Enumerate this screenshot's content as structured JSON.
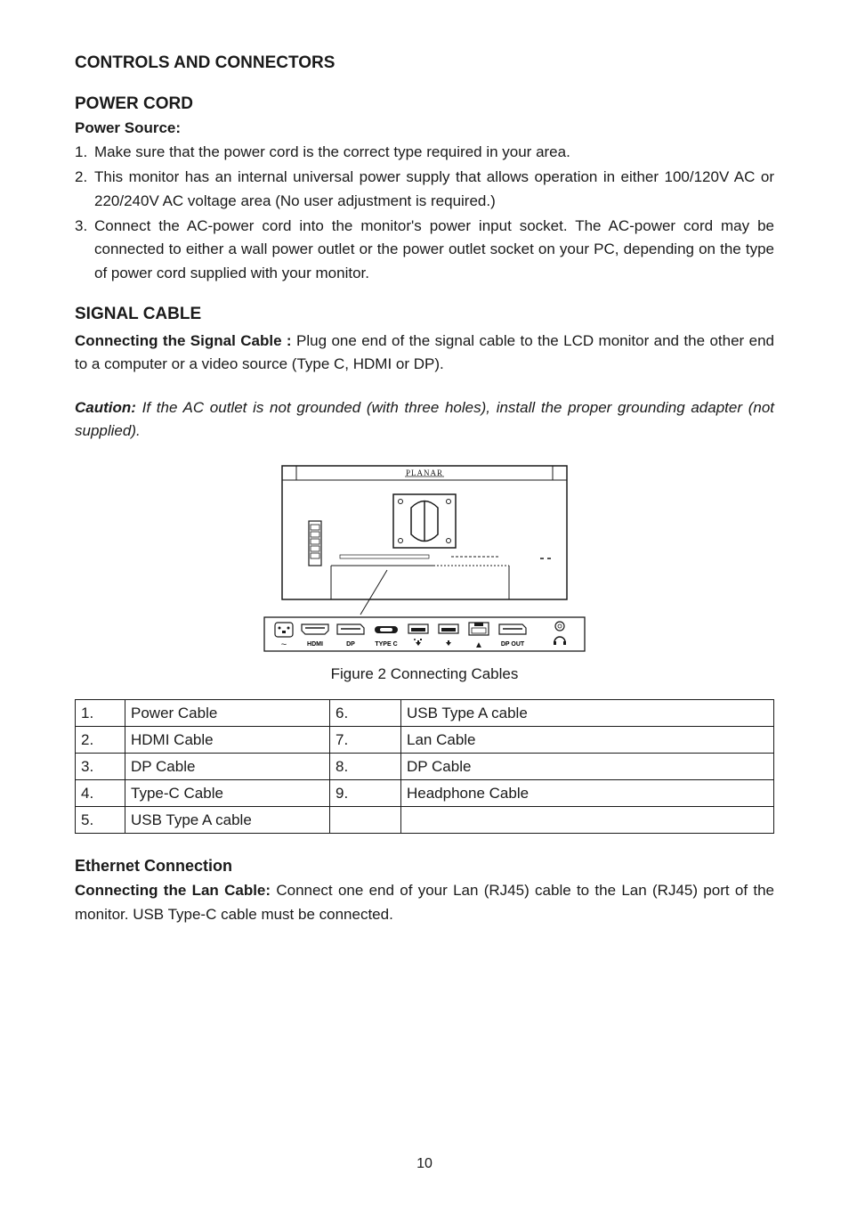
{
  "section_title": "CONTROLS AND CONNECTORS",
  "power_cord": {
    "title": "POWER CORD",
    "subtitle": "Power Source:",
    "items": [
      "Make sure that the power cord is the correct type required in your area.",
      "This monitor has an internal universal power supply that allows operation in either 100/120V AC or 220/240V AC voltage area (No user adjustment is required.)",
      "Connect the AC-power cord into the monitor's power input socket. The AC-power cord may be connected to either a wall power outlet or the power outlet socket on your PC, depending on the type of power cord supplied with your monitor."
    ]
  },
  "signal_cable": {
    "title": "SIGNAL CABLE",
    "body_bold": "Connecting the Signal Cable :",
    "body_rest": " Plug one end of the signal cable to the LCD monitor and the other end to a computer or a video source (Type C, HDMI or DP)."
  },
  "caution": {
    "label": "Caution:",
    "text": " If the AC outlet is not grounded (with three holes), install the proper grounding adapter (not supplied)."
  },
  "figure": {
    "caption": "Figure 2   Connecting Cables",
    "brand": "PLANAR",
    "ports": {
      "hdmi": "HDMI",
      "dp": "DP",
      "typec": "TYPE C",
      "dpout": "DP OUT"
    }
  },
  "table": {
    "r1": {
      "n": "1.",
      "name": "Power Cable",
      "n2": "6.",
      "name2": "USB Type A cable"
    },
    "r2": {
      "n": "2.",
      "name": "HDMI Cable",
      "n2": "7.",
      "name2": "Lan Cable"
    },
    "r3": {
      "n": "3.",
      "name": "DP Cable",
      "n2": "8.",
      "name2": "DP Cable"
    },
    "r4": {
      "n": "4.",
      "name": "Type-C Cable",
      "n2": "9.",
      "name2": "Headphone Cable"
    },
    "r5": {
      "n": "5.",
      "name": "USB Type A cable",
      "n2": "",
      "name2": ""
    }
  },
  "ethernet": {
    "title": "Ethernet Connection",
    "body_bold": "Connecting the Lan Cable:",
    "body_rest": " Connect one end of your Lan (RJ45) cable to the Lan (RJ45) port of the monitor. USB Type-C cable must be connected."
  },
  "page_number": "10"
}
